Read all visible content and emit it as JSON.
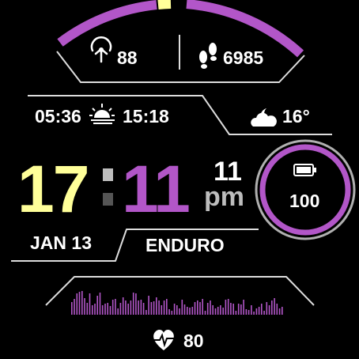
{
  "colors": {
    "accent": "#b256c8",
    "hour_color": "#ffff99",
    "progress_marker": "#ffff99",
    "track": "#222222",
    "divider": "#dddddd",
    "ring_outer": "#b0b0b0"
  },
  "top_arc": {
    "progress_fraction": 0.45
  },
  "stats": {
    "left_icon": "body-battery-icon",
    "left_value": "88",
    "right_icon": "footsteps-icon",
    "right_value": "6985"
  },
  "sun": {
    "sunrise": "05:36",
    "icon": "sunrise-icon",
    "sunset": "15:18"
  },
  "weather": {
    "icon": "partly-cloudy-icon",
    "temperature": "16°"
  },
  "time": {
    "hour": "17",
    "minute": "11",
    "right_top": "11",
    "right_bottom": "pm"
  },
  "battery": {
    "icon": "battery-icon",
    "value": "100",
    "level_fraction": 1.0
  },
  "date": "JAN 13",
  "activity_profile": "ENDURO",
  "heart_rate": {
    "icon": "heart-rate-icon",
    "value": "80",
    "history": [
      16,
      20,
      27,
      29,
      30,
      21,
      15,
      27,
      12,
      14,
      24,
      28,
      12,
      14,
      15,
      11,
      19,
      20,
      8,
      15,
      22,
      18,
      14,
      18,
      28,
      27,
      18,
      19,
      15,
      6,
      24,
      16,
      17,
      22,
      18,
      12,
      18,
      20,
      7,
      5,
      14,
      12,
      8,
      19,
      13,
      10,
      9,
      10,
      16,
      18,
      16,
      20,
      5,
      15,
      18,
      12,
      8,
      10,
      12,
      9,
      19,
      20,
      15,
      14,
      5,
      14,
      13,
      19,
      7,
      6,
      12,
      4,
      8,
      10,
      14,
      5,
      16,
      12,
      18,
      21,
      14,
      8,
      10
    ]
  }
}
